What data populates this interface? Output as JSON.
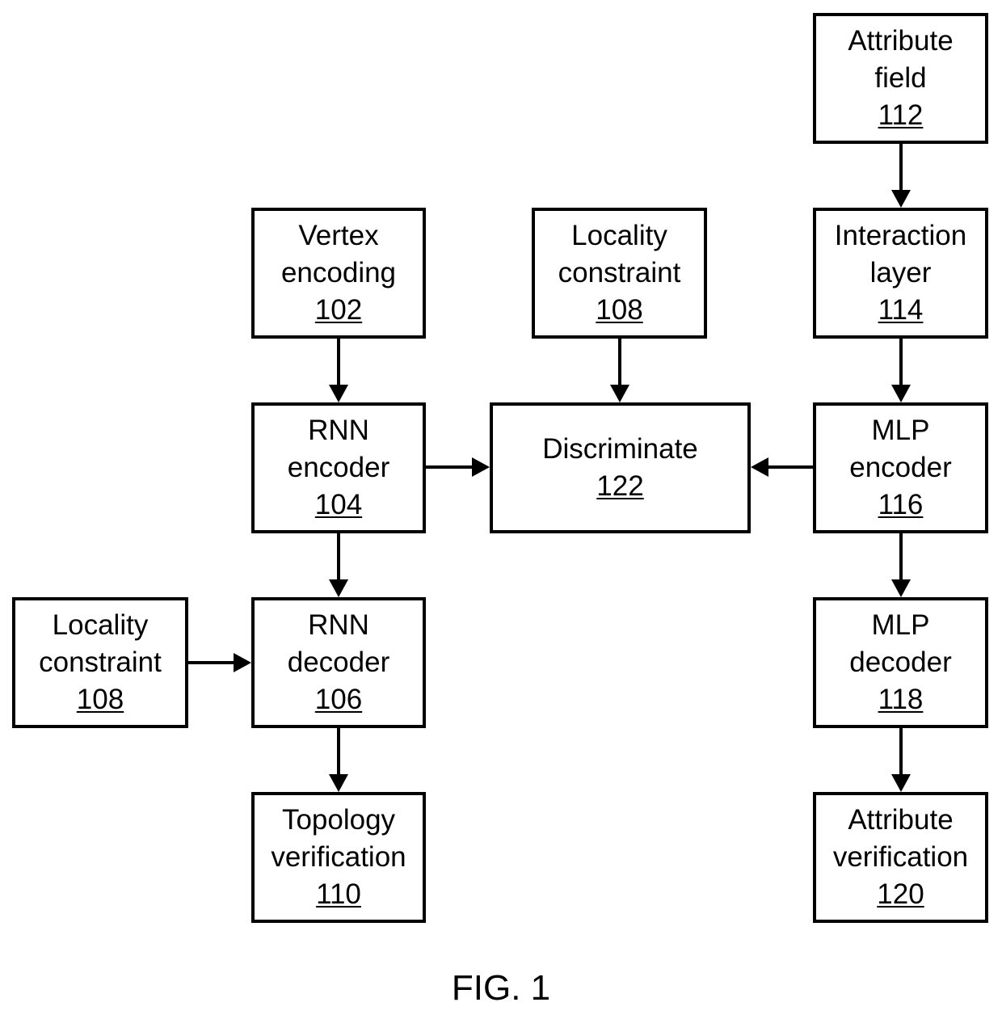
{
  "figure_label": "FIG. 1",
  "blocks": {
    "attribute_field": {
      "line1": "Attribute",
      "line2": "field",
      "ref": "112"
    },
    "vertex_encoding": {
      "line1": "Vertex",
      "line2": "encoding",
      "ref": "102"
    },
    "locality_constraint_top": {
      "line1": "Locality",
      "line2": "constraint",
      "ref": "108"
    },
    "interaction_layer": {
      "line1": "Interaction",
      "line2": "layer",
      "ref": "114"
    },
    "rnn_encoder": {
      "line1": "RNN",
      "line2": "encoder",
      "ref": "104"
    },
    "discriminate": {
      "line1": "Discriminate",
      "ref": "122"
    },
    "mlp_encoder": {
      "line1": "MLP",
      "line2": "encoder",
      "ref": "116"
    },
    "locality_constraint_left": {
      "line1": "Locality",
      "line2": "constraint",
      "ref": "108"
    },
    "rnn_decoder": {
      "line1": "RNN",
      "line2": "decoder",
      "ref": "106"
    },
    "mlp_decoder": {
      "line1": "MLP",
      "line2": "decoder",
      "ref": "118"
    },
    "topology_verification": {
      "line1": "Topology",
      "line2": "verification",
      "ref": "110"
    },
    "attribute_verification": {
      "line1": "Attribute",
      "line2": "verification",
      "ref": "120"
    }
  },
  "connections": [
    {
      "from": "attribute_field",
      "to": "interaction_layer"
    },
    {
      "from": "vertex_encoding",
      "to": "rnn_encoder"
    },
    {
      "from": "locality_constraint_top",
      "to": "discriminate"
    },
    {
      "from": "interaction_layer",
      "to": "mlp_encoder"
    },
    {
      "from": "rnn_encoder",
      "to": "discriminate"
    },
    {
      "from": "mlp_encoder",
      "to": "discriminate"
    },
    {
      "from": "rnn_encoder",
      "to": "rnn_decoder"
    },
    {
      "from": "locality_constraint_left",
      "to": "rnn_decoder"
    },
    {
      "from": "mlp_encoder",
      "to": "mlp_decoder"
    },
    {
      "from": "rnn_decoder",
      "to": "topology_verification"
    },
    {
      "from": "mlp_decoder",
      "to": "attribute_verification"
    }
  ]
}
